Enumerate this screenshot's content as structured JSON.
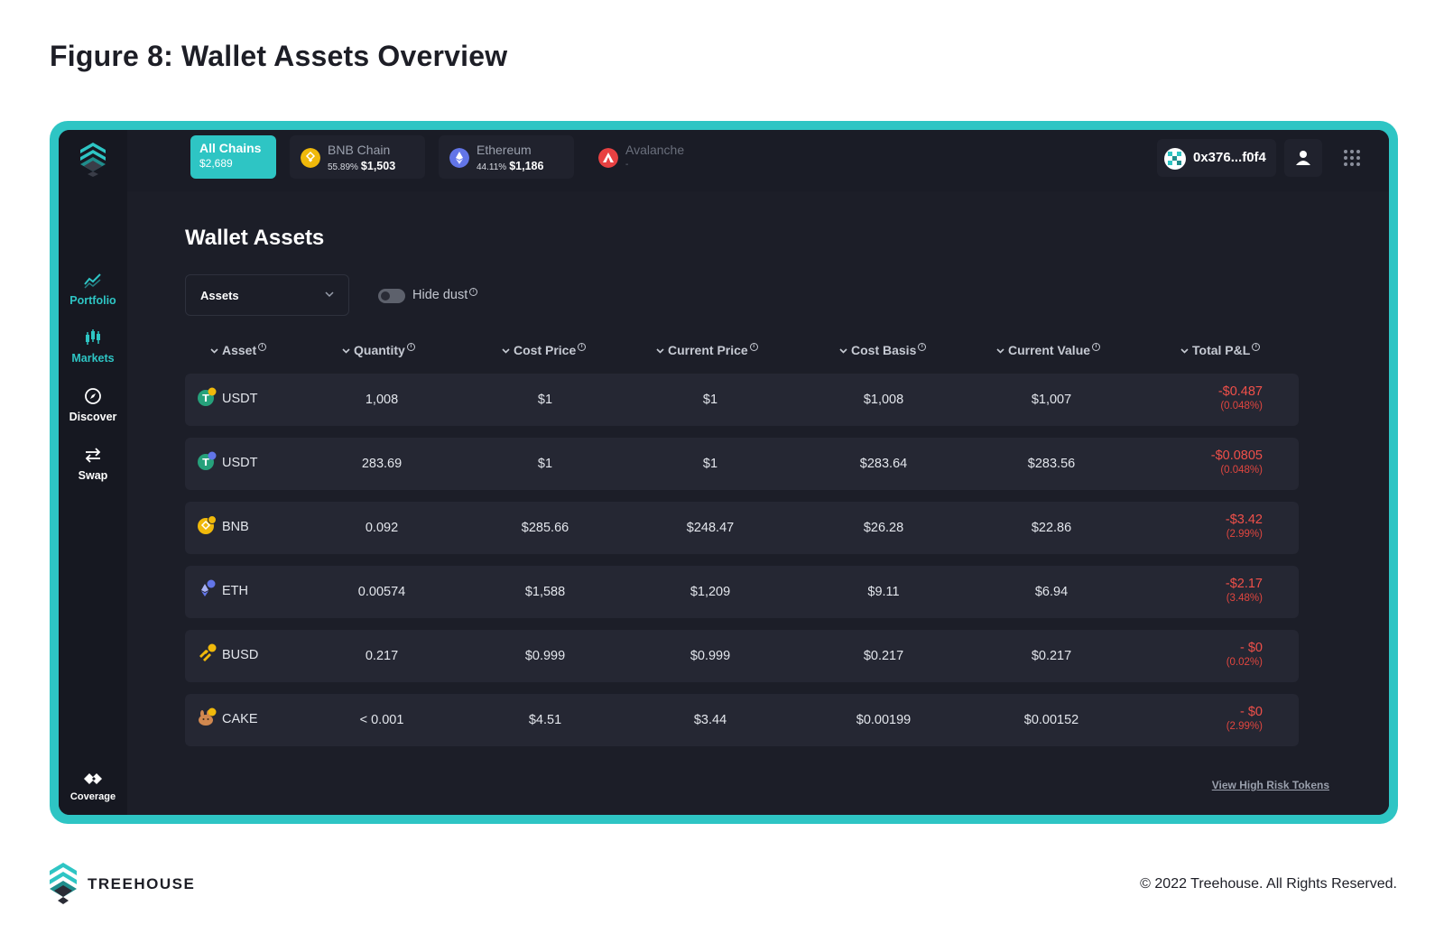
{
  "figure_title": "Figure 8: Wallet Assets Overview",
  "chains": {
    "all": {
      "name": "All Chains",
      "value": "$2,689"
    },
    "bnb": {
      "name": "BNB Chain",
      "pct": "55.89%",
      "value": "$1,503"
    },
    "eth": {
      "name": "Ethereum",
      "pct": "44.11%",
      "value": "$1,186"
    },
    "avax": {
      "name": "Avalanche",
      "value": "-"
    }
  },
  "wallet": {
    "address": "0x376...f0f4"
  },
  "sidebar": {
    "portfolio": "Portfolio",
    "markets": "Markets",
    "discover": "Discover",
    "swap": "Swap",
    "coverage": "Coverage"
  },
  "main": {
    "title": "Wallet Assets",
    "select_value": "Assets",
    "hide_dust": "Hide dust",
    "view_high_risk": "View High Risk Tokens"
  },
  "table": {
    "headers": [
      "Asset",
      "Quantity",
      "Cost Price",
      "Current Price",
      "Cost Basis",
      "Current Value",
      "Total P&L"
    ],
    "rows": [
      {
        "asset": "USDT",
        "quantity": "1,008",
        "cost_price": "$1",
        "current_price": "$1",
        "cost_basis": "$1,008",
        "current_value": "$1,007",
        "pnl": "-$0.487",
        "pnl_pct": "(0.048%)",
        "icon": "usdt-bnb-icon"
      },
      {
        "asset": "USDT",
        "quantity": "283.69",
        "cost_price": "$1",
        "current_price": "$1",
        "cost_basis": "$283.64",
        "current_value": "$283.56",
        "pnl": "-$0.0805",
        "pnl_pct": "(0.048%)",
        "icon": "usdt-eth-icon"
      },
      {
        "asset": "BNB",
        "quantity": "0.092",
        "cost_price": "$285.66",
        "current_price": "$248.47",
        "cost_basis": "$26.28",
        "current_value": "$22.86",
        "pnl": "-$3.42",
        "pnl_pct": "(2.99%)",
        "icon": "bnb-icon"
      },
      {
        "asset": "ETH",
        "quantity": "0.00574",
        "cost_price": "$1,588",
        "current_price": "$1,209",
        "cost_basis": "$9.11",
        "current_value": "$6.94",
        "pnl": "-$2.17",
        "pnl_pct": "(3.48%)",
        "icon": "eth-icon"
      },
      {
        "asset": "BUSD",
        "quantity": "0.217",
        "cost_price": "$0.999",
        "current_price": "$0.999",
        "cost_basis": "$0.217",
        "current_value": "$0.217",
        "pnl": "- $0",
        "pnl_pct": "(0.02%)",
        "icon": "busd-icon"
      },
      {
        "asset": "CAKE",
        "quantity": "< 0.001",
        "cost_price": "$4.51",
        "current_price": "$3.44",
        "cost_basis": "$0.00199",
        "current_value": "$0.00152",
        "pnl": "- $0",
        "pnl_pct": "(2.99%)",
        "icon": "cake-icon"
      }
    ]
  },
  "footer": {
    "brand": "TREEHOUSE",
    "copyright": "© 2022 Treehouse. All Rights Reserved."
  },
  "colors": {
    "accent": "#2ec5c4",
    "background": "#1a1c26",
    "row": "#252733",
    "negative": "#f0504a"
  }
}
